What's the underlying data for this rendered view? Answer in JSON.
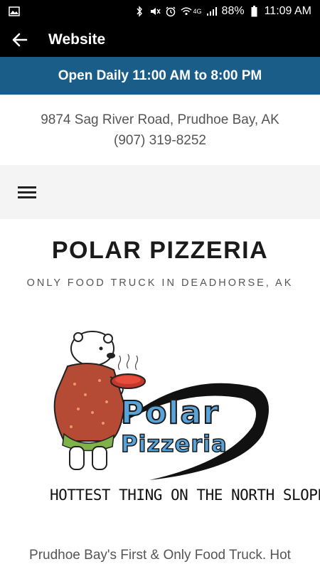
{
  "status_bar": {
    "battery": "88%",
    "time": "11:09 AM",
    "network": "4G",
    "icons": [
      "image-icon",
      "bluetooth-icon",
      "mute-icon",
      "alarm-icon",
      "wifi-icon",
      "signal-icon",
      "battery-icon"
    ]
  },
  "app_bar": {
    "title": "Website",
    "back_icon": "arrow-left-icon"
  },
  "banner": {
    "hours": "Open Daily 11:00 AM to 8:00 PM",
    "color": "#1a5d88"
  },
  "address": {
    "street": "9874 Sag River Road, Prudhoe Bay, AK",
    "phone": "(907) 319-8252"
  },
  "nav": {
    "menu_icon": "hamburger-menu-icon"
  },
  "site": {
    "title": "POLAR PIZZERIA",
    "tagline": "ONLY FOOD TRUCK IN DEADHORSE, AK"
  },
  "logo": {
    "word1": "Polar",
    "word2": "Pizzeria",
    "slogan": "HOTTEST THING ON THE NORTH SLOPE"
  },
  "intro": {
    "text": "Prudhoe Bay's First & Only Food Truck. Hot"
  }
}
